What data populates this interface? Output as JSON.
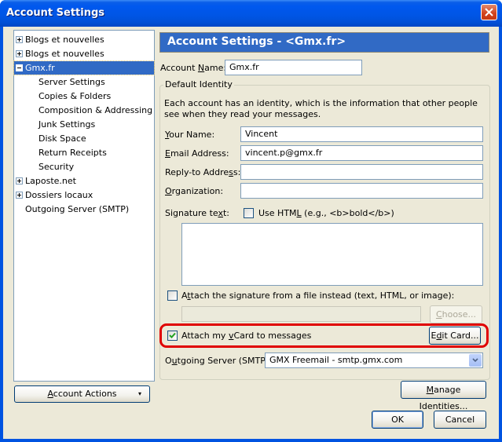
{
  "window": {
    "title": "Account Settings"
  },
  "tree": {
    "items": [
      {
        "label": "Blogs et nouvelles",
        "expander": "plus",
        "indent": 0,
        "selected": false
      },
      {
        "label": "Blogs et nouvelles",
        "expander": "plus",
        "indent": 0,
        "selected": false
      },
      {
        "label": "Gmx.fr",
        "expander": "minus",
        "indent": 0,
        "selected": true
      },
      {
        "label": "Server Settings",
        "expander": "none",
        "indent": 1,
        "selected": false
      },
      {
        "label": "Copies & Folders",
        "expander": "none",
        "indent": 1,
        "selected": false
      },
      {
        "label": "Composition & Addressing",
        "expander": "none",
        "indent": 1,
        "selected": false
      },
      {
        "label": "Junk Settings",
        "expander": "none",
        "indent": 1,
        "selected": false
      },
      {
        "label": "Disk Space",
        "expander": "none",
        "indent": 1,
        "selected": false
      },
      {
        "label": "Return Receipts",
        "expander": "none",
        "indent": 1,
        "selected": false
      },
      {
        "label": "Security",
        "expander": "none",
        "indent": 1,
        "selected": false
      },
      {
        "label": "Laposte.net",
        "expander": "plus",
        "indent": 0,
        "selected": false
      },
      {
        "label": "Dossiers locaux",
        "expander": "plus",
        "indent": 0,
        "selected": false
      },
      {
        "label": "Outgoing Server (SMTP)",
        "expander": "none",
        "indent": 0,
        "selected": false
      }
    ],
    "account_actions": {
      "pre": "",
      "key": "A",
      "post": "ccount Actions",
      "arrow": "▾"
    }
  },
  "panel": {
    "header": "Account Settings - <Gmx.fr>",
    "account_name": {
      "label_pre": "Account ",
      "label_key": "N",
      "label_post": "ame:",
      "value": "Gmx.fr"
    },
    "default_identity": {
      "legend": "Default Identity",
      "description": "Each account has an identity, which is the information that other people see when they read your messages.",
      "your_name": {
        "label_pre": "",
        "label_key": "Y",
        "label_post": "our Name:",
        "value": "Vincent"
      },
      "email": {
        "label_pre": "",
        "label_key": "E",
        "label_post": "mail Address:",
        "value": "vincent.p@gmx.fr"
      },
      "reply_to": {
        "label_pre": "Reply-to Addre",
        "label_key": "s",
        "label_post": "s:",
        "value": ""
      },
      "organization": {
        "label_pre": "",
        "label_key": "O",
        "label_post": "rganization:",
        "value": ""
      },
      "signature": {
        "label_pre": "Signature te",
        "label_key": "x",
        "label_post": "t:",
        "use_html": {
          "label_pre": "Use HTM",
          "label_key": "L",
          "label_post": " (e.g., <b>bold</b>)",
          "checked": false
        },
        "value": ""
      },
      "attach_file": {
        "label_pre": "A",
        "label_key": "t",
        "label_post": "tach the signature from a file instead (text, HTML, or image):",
        "checked": false,
        "path": ""
      },
      "choose_button": {
        "pre": "",
        "key": "C",
        "post": "hoose..."
      },
      "attach_vcard": {
        "label_pre": "Attach my ",
        "label_key": "v",
        "label_post": "Card to messages",
        "checked": true
      },
      "edit_card_button": {
        "pre": "E",
        "key": "d",
        "post": "it Card..."
      },
      "outgoing_server": {
        "label_pre": "O",
        "label_key": "u",
        "label_post": "tgoing Server (SMTP):",
        "value": "GMX Freemail - smtp.gmx.com"
      }
    },
    "manage_identities_button": {
      "pre": "",
      "key": "M",
      "post": "anage Identities..."
    },
    "ok_button": "OK",
    "cancel_button": "Cancel"
  },
  "colors": {
    "selection": "#316ac5",
    "highlight_ring": "#e00000",
    "dialog_bg": "#ece9d8"
  }
}
